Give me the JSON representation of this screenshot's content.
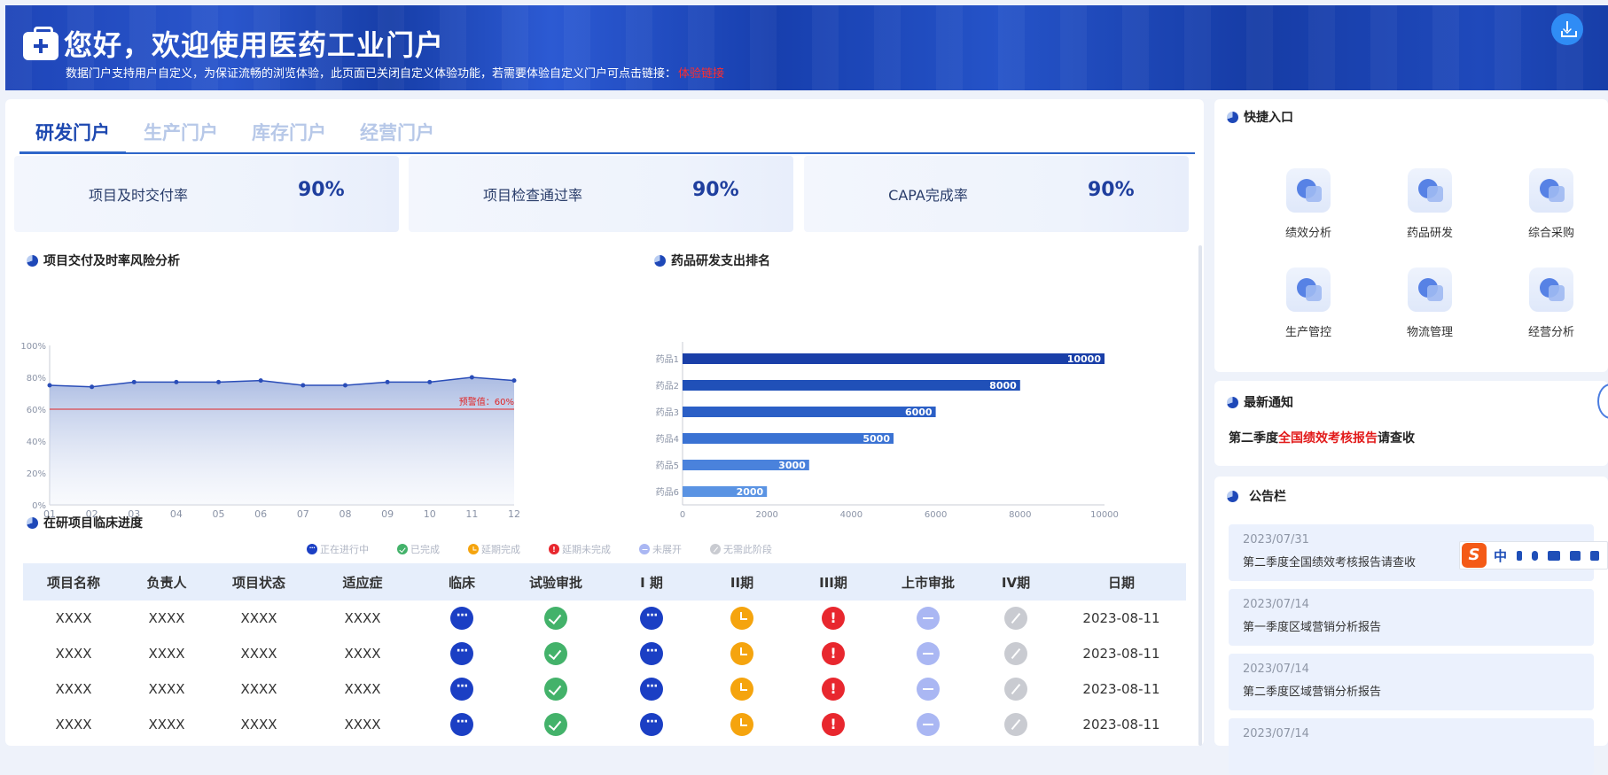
{
  "banner": {
    "title": "您好，欢迎使用医药工业门户",
    "subtitle": "数据门户支持用户自定义，为保证流畅的浏览体验，此页面已关闭自定义体验功能，若需要体验自定义门户可点击链接：",
    "link_text": "体验链接",
    "download_icon": "download-icon",
    "logo_icon": "medical-kit-icon"
  },
  "tabs": [
    "研发门户",
    "生产门户",
    "库存门户",
    "经营门户"
  ],
  "active_tab": 0,
  "kpis": [
    {
      "label": "项目及时交付率",
      "value": "90%"
    },
    {
      "label": "项目检查通过率",
      "value": "90%"
    },
    {
      "label": "CAPA完成率",
      "value": "90%"
    }
  ],
  "sections": {
    "line_title": "项目交付及时率风险分析",
    "bar_title": "药品研发支出排名",
    "table_title": "在研项目临床进度"
  },
  "chart_data": [
    {
      "type": "area",
      "title": "项目交付及时率风险分析",
      "x": [
        "01",
        "02",
        "03",
        "04",
        "05",
        "06",
        "07",
        "08",
        "09",
        "10",
        "11",
        "12"
      ],
      "values": [
        75,
        74,
        77,
        77,
        77,
        78,
        75,
        75,
        77,
        77,
        80,
        78
      ],
      "y_ticks": [
        "0%",
        "20%",
        "40%",
        "60%",
        "80%",
        "100%"
      ],
      "ylim": [
        0,
        100
      ],
      "threshold": {
        "value": 60,
        "label": "预警值：60%"
      },
      "colors": {
        "line": "#2a4db8",
        "threshold": "#e02424"
      }
    },
    {
      "type": "bar",
      "orientation": "horizontal",
      "title": "药品研发支出排名",
      "categories": [
        "药品1",
        "药品2",
        "药品3",
        "药品4",
        "药品5",
        "药品6"
      ],
      "values": [
        10000,
        8000,
        6000,
        5000,
        3000,
        2000
      ],
      "x_ticks": [
        "0",
        "2000",
        "4000",
        "6000",
        "8000",
        "10000"
      ],
      "xlim": [
        0,
        10000
      ],
      "colors": [
        "#1a3fa8",
        "#2050b8",
        "#2b5fc6",
        "#3a72d3",
        "#4a82dc",
        "#5a93e3"
      ]
    }
  ],
  "legend": [
    {
      "label": "正在进行中",
      "icon": "ongoing-icon",
      "color": "#1b3fc4"
    },
    {
      "label": "已完成",
      "icon": "done-icon",
      "color": "#43b26a"
    },
    {
      "label": "延期完成",
      "icon": "delayed-done-icon",
      "color": "#f5a40e"
    },
    {
      "label": "延期未完成",
      "icon": "delayed-undone-icon",
      "color": "#e8272e"
    },
    {
      "label": "未展开",
      "icon": "not-started-icon",
      "color": "#aab7f3"
    },
    {
      "label": "无需此阶段",
      "icon": "not-needed-icon",
      "color": "#c9cbd1"
    }
  ],
  "table": {
    "headers": [
      "项目名称",
      "负责人",
      "项目状态",
      "适应症",
      "临床",
      "试验审批",
      "I 期",
      "II期",
      "III期",
      "上市审批",
      "IV期",
      "日期"
    ],
    "rows": [
      {
        "name": "XXXX",
        "owner": "XXXX",
        "status": "XXXX",
        "indication": "XXXX",
        "date": "2023-08-11"
      },
      {
        "name": "XXXX",
        "owner": "XXXX",
        "status": "XXXX",
        "indication": "XXXX",
        "date": "2023-08-11"
      },
      {
        "name": "XXXX",
        "owner": "XXXX",
        "status": "XXXX",
        "indication": "XXXX",
        "date": "2023-08-11"
      },
      {
        "name": "XXXX",
        "owner": "XXXX",
        "status": "XXXX",
        "indication": "XXXX",
        "date": "2023-08-11"
      }
    ],
    "stage_status": [
      "ongoing",
      "done",
      "ongoing",
      "delayed-done",
      "delayed-undone",
      "not-started",
      "not-needed"
    ]
  },
  "quick": {
    "title": "快捷入口",
    "items": [
      {
        "label": "绩效分析",
        "icon": "performance-analysis-icon"
      },
      {
        "label": "药品研发",
        "icon": "drug-rd-icon"
      },
      {
        "label": "综合采购",
        "icon": "procurement-icon"
      },
      {
        "label": "生产管控",
        "icon": "production-control-icon"
      },
      {
        "label": "物流管理",
        "icon": "logistics-icon"
      },
      {
        "label": "经营分析",
        "icon": "business-analysis-icon"
      }
    ]
  },
  "notice": {
    "title": "最新通知",
    "prefix": "第二季度",
    "highlight": "全国绩效考核报告",
    "suffix": "请查收"
  },
  "board": {
    "title": "公告栏",
    "items": [
      {
        "date": "2023/07/31",
        "title": "第二季度全国绩效考核报告请查收"
      },
      {
        "date": "2023/07/14",
        "title": "第一季度区域营销分析报告"
      },
      {
        "date": "2023/07/14",
        "title": "第二季度区域营销分析报告"
      },
      {
        "date": "2023/07/14",
        "title": ""
      }
    ]
  },
  "ime": {
    "logo": "S",
    "mode": "中"
  }
}
